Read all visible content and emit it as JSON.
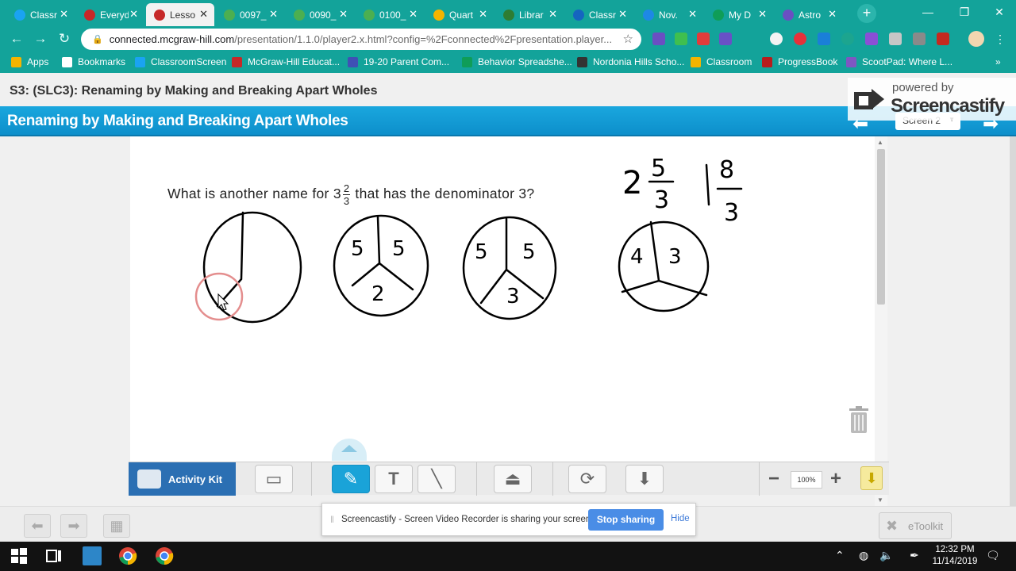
{
  "tabs": [
    {
      "label": "Classr",
      "active": false
    },
    {
      "label": "Everyd",
      "active": false
    },
    {
      "label": "Lesso",
      "active": true
    },
    {
      "label": "0097_",
      "active": false
    },
    {
      "label": "0090_",
      "active": false
    },
    {
      "label": "0100_",
      "active": false
    },
    {
      "label": "Quart",
      "active": false
    },
    {
      "label": "Librar",
      "active": false
    },
    {
      "label": "Classr",
      "active": false
    },
    {
      "label": "Nov.",
      "active": false
    },
    {
      "label": "My D",
      "active": false
    },
    {
      "label": "Astro",
      "active": false
    }
  ],
  "window_controls": {
    "minimize": "—",
    "restore": "❐",
    "close": "✕"
  },
  "address": {
    "host": "connected.mcgraw-hill.com",
    "path": "/presentation/1.1.0/player2.x.html?config=%2Fconnected%2Fpresentation.player..."
  },
  "bookmarks": [
    {
      "label": "Apps"
    },
    {
      "label": "Bookmarks"
    },
    {
      "label": "ClassroomScreen"
    },
    {
      "label": "McGraw-Hill Educat..."
    },
    {
      "label": "19-20 Parent Com..."
    },
    {
      "label": "Behavior Spreadshe..."
    },
    {
      "label": "Nordonia Hills Scho..."
    },
    {
      "label": "Classroom"
    },
    {
      "label": "ProgressBook"
    },
    {
      "label": "ScootPad: Where L..."
    }
  ],
  "bookmarks_more": "»",
  "page_title": "S3: (SLC3): Renaming by Making and Breaking Apart Wholes",
  "lesson_header": "Renaming by Making and Breaking Apart Wholes",
  "screen_select": "Screen 2",
  "screencastify": {
    "powered_by": "powered by",
    "name": "Screencastify"
  },
  "question": {
    "before": "What is another name for 3",
    "frac_num": "2",
    "frac_den": "3",
    "after": "that has the denominator 3?"
  },
  "handwriting": {
    "answer1_whole": "2",
    "answer1_num": "5",
    "answer1_den": "3",
    "answer2_whole": "1",
    "answer2_num": "8",
    "answer2_den": "3",
    "circle2_parts": [
      "5",
      "5",
      "2"
    ],
    "circle3_parts": [
      "5",
      "5",
      "3"
    ],
    "circle4_parts": [
      "4",
      "3"
    ]
  },
  "toolbar": {
    "activity_kit": "Activity Kit",
    "zoom": "100%"
  },
  "share_bar": {
    "message": "Screencastify - Screen Video Recorder is sharing your screen.",
    "stop": "Stop sharing",
    "hide": "Hide"
  },
  "etoolkit": "eToolkit",
  "clock": {
    "time": "12:32 PM",
    "date": "11/14/2019"
  },
  "colors": {
    "chrome": "#13a39a",
    "lesson_blue": "#1aa7de",
    "active_tool": "#1aa3d8",
    "stop_button": "#4a8de6"
  }
}
